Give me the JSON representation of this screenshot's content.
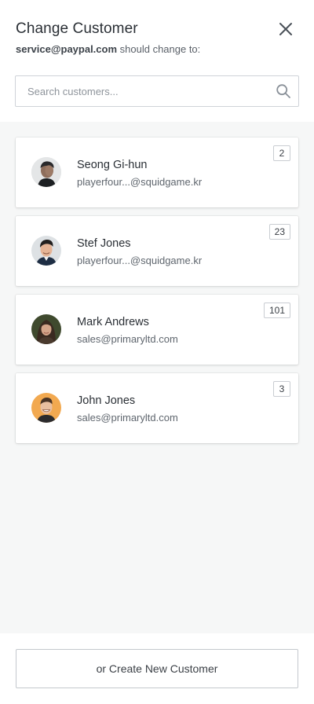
{
  "header": {
    "title": "Change Customer",
    "subtitle_email": "service@paypal.com",
    "subtitle_rest": " should change to:",
    "close_icon": "close-icon"
  },
  "search": {
    "placeholder": "Search customers...",
    "icon": "search-icon"
  },
  "customers": [
    {
      "name": "Seong Gi-hun",
      "email": "playerfour...@squidgame.kr",
      "count": "2",
      "avatar": "avatar-seong-gi-hun"
    },
    {
      "name": "Stef Jones",
      "email": "playerfour...@squidgame.kr",
      "count": "23",
      "avatar": "avatar-stef-jones"
    },
    {
      "name": "Mark Andrews",
      "email": "sales@primaryltd.com",
      "count": "101",
      "avatar": "avatar-mark-andrews"
    },
    {
      "name": "John Jones",
      "email": "sales@primaryltd.com",
      "count": "3",
      "avatar": "avatar-john-jones"
    }
  ],
  "footer": {
    "create_label": "or Create New Customer"
  },
  "colors": {
    "list_background": "#f6f7f7",
    "text_primary": "#2a2f35",
    "border": "#cfd3d8"
  }
}
